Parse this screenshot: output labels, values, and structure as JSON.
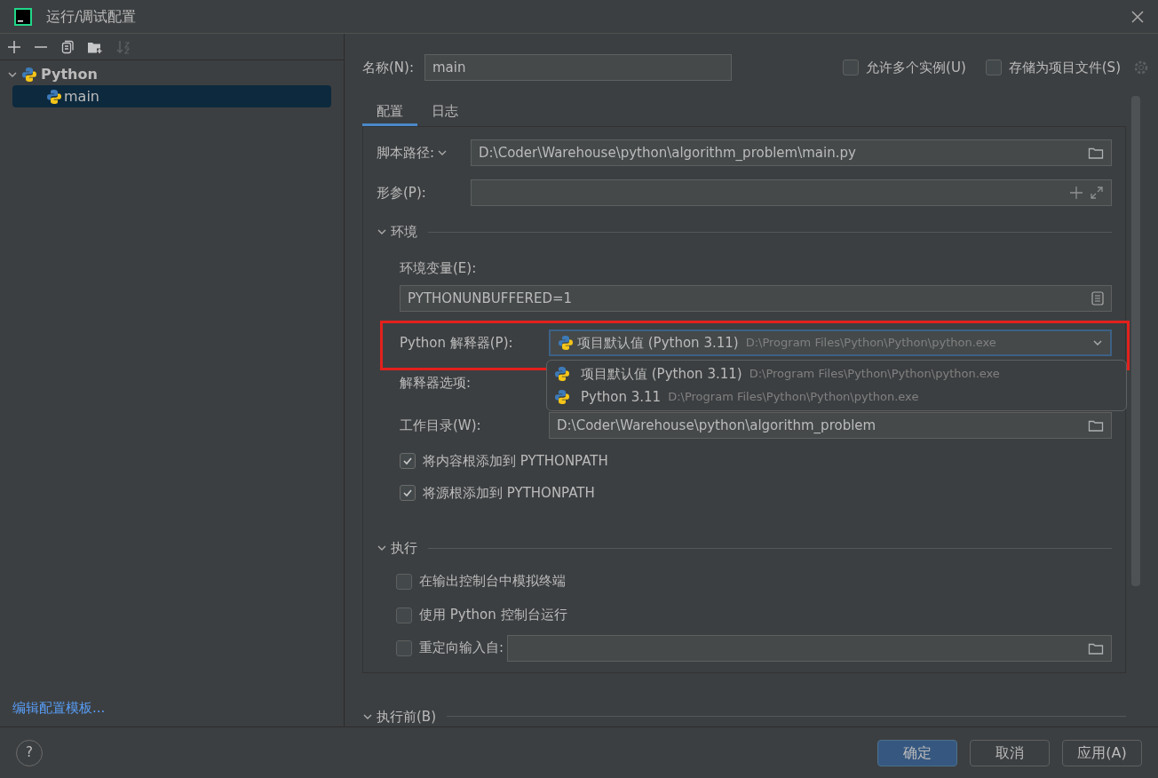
{
  "window": {
    "title": "运行/调试配置"
  },
  "toolbar": [
    {
      "kind": "add",
      "disabled": false
    },
    {
      "kind": "remove",
      "disabled": false
    },
    {
      "kind": "copy",
      "disabled": false
    },
    {
      "kind": "folder",
      "disabled": false
    },
    {
      "kind": "sort",
      "disabled": true
    }
  ],
  "tree": [
    {
      "label": "Python",
      "expanded": true,
      "children": [
        {
          "label": "main",
          "selected": true
        }
      ]
    }
  ],
  "template_link": "编辑配置模板...",
  "name_field": {
    "label": "名称(N):",
    "value": "main"
  },
  "top_options": [
    {
      "label": "允许多个实例(U)",
      "checked": false
    },
    {
      "label": "存储为项目文件(S)",
      "checked": false
    }
  ],
  "tabs": [
    {
      "label": "配置",
      "selected": true
    },
    {
      "label": "日志",
      "selected": false
    }
  ],
  "script_path": {
    "label": "脚本路径:",
    "value": "D:\\Coder\\Warehouse\\python\\algorithm_problem\\main.py"
  },
  "parameters": {
    "label": "形参(P):"
  },
  "environment": {
    "title": "环境",
    "expanded": true,
    "env_vars": {
      "label": "环境变量(E):",
      "value": "PYTHONUNBUFFERED=1"
    },
    "interpreter": {
      "label": "Python 解释器(P):",
      "name": "项目默认值 (Python 3.11)",
      "path": "D:\\Program Files\\Python\\Python\\python.exe",
      "highlighted": true,
      "open": true
    },
    "interpreter_menu": [
      {
        "name": "项目默认值 (Python 3.11)",
        "path": "D:\\Program Files\\Python\\Python\\python.exe"
      },
      {
        "name": "Python 3.11",
        "path": "D:\\Program Files\\Python\\Python\\python.exe"
      }
    ],
    "interpreter_options": {
      "label": "解释器选项:"
    },
    "working_dir": {
      "label": "工作目录(W):",
      "value": "D:\\Coder\\Warehouse\\python\\algorithm_problem"
    },
    "checkboxes": [
      {
        "label": "将内容根添加到 PYTHONPATH",
        "checked": true
      },
      {
        "label": "将源根添加到 PYTHONPATH",
        "checked": true
      }
    ]
  },
  "execution": {
    "title": "执行",
    "expanded": true,
    "checkboxes": [
      {
        "label": "在输出控制台中模拟终端",
        "checked": false
      },
      {
        "label": "使用 Python 控制台运行",
        "checked": false
      }
    ],
    "redirect": {
      "label": "重定向输入自:",
      "checked": false
    }
  },
  "before_launch": {
    "title": "执行前(B)",
    "expanded": true
  },
  "help": "?",
  "buttons": [
    {
      "label": "确定",
      "primary": true
    },
    {
      "label": "取消",
      "primary": false
    },
    {
      "label": "应用(A)",
      "primary": false
    }
  ]
}
